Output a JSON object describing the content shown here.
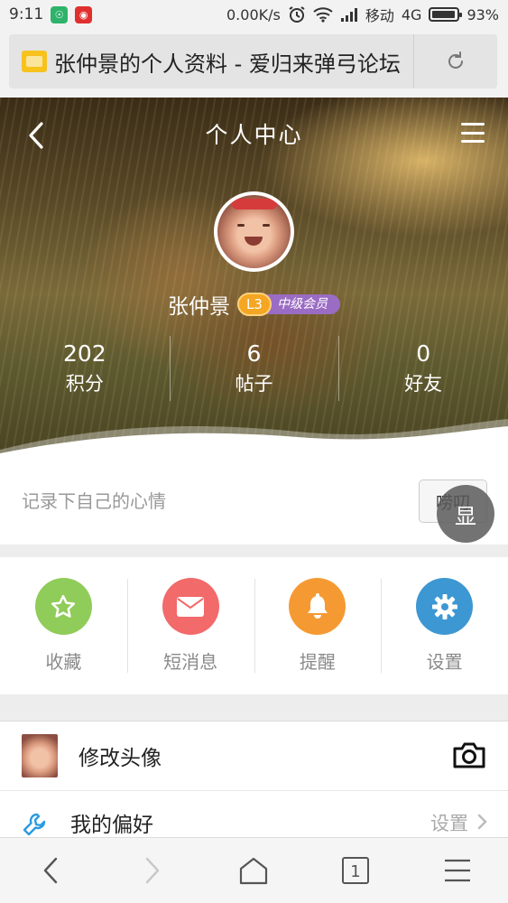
{
  "status_bar": {
    "time": "9:11",
    "network_speed": "0.00K/s",
    "carrier": "移动",
    "network_type": "4G",
    "battery": "93%",
    "battery_level": 0.93,
    "badge1_color": "#2fb36b",
    "badge2_color": "#e02f2f"
  },
  "browser": {
    "page_title": "张仲景的个人资料 - 爱归来弹弓论坛",
    "reload_icon": "reload-icon"
  },
  "header": {
    "title": "个人中心",
    "back_icon": "chevron-left-icon",
    "menu_icon": "hamburger-menu-icon"
  },
  "profile": {
    "username": "张仲景",
    "level": "L3",
    "rank": "中级会员",
    "stats": [
      {
        "value": "202",
        "label": "积分"
      },
      {
        "value": "6",
        "label": "帖子"
      },
      {
        "value": "0",
        "label": "好友"
      }
    ]
  },
  "mood": {
    "placeholder": "记录下自己的心情",
    "button": "唠叨"
  },
  "floating_button": "显",
  "actions": [
    {
      "label": "收藏",
      "icon": "star-icon",
      "color": "#8fcc5a"
    },
    {
      "label": "短消息",
      "icon": "envelope-icon",
      "color": "#f26a6a"
    },
    {
      "label": "提醒",
      "icon": "bell-icon",
      "color": "#f59a33"
    },
    {
      "label": "设置",
      "icon": "gear-icon",
      "color": "#3d97d3"
    }
  ],
  "list": {
    "change_avatar": {
      "label": "修改头像",
      "icon": "camera-icon"
    },
    "preferences": {
      "label": "我的偏好",
      "value": "设置",
      "icon": "wrench-icon"
    }
  },
  "bottom_nav": {
    "tab_count": "1",
    "icons": [
      "back-arrow-icon",
      "forward-arrow-icon",
      "home-icon",
      "tabs-icon",
      "menu-icon"
    ]
  }
}
